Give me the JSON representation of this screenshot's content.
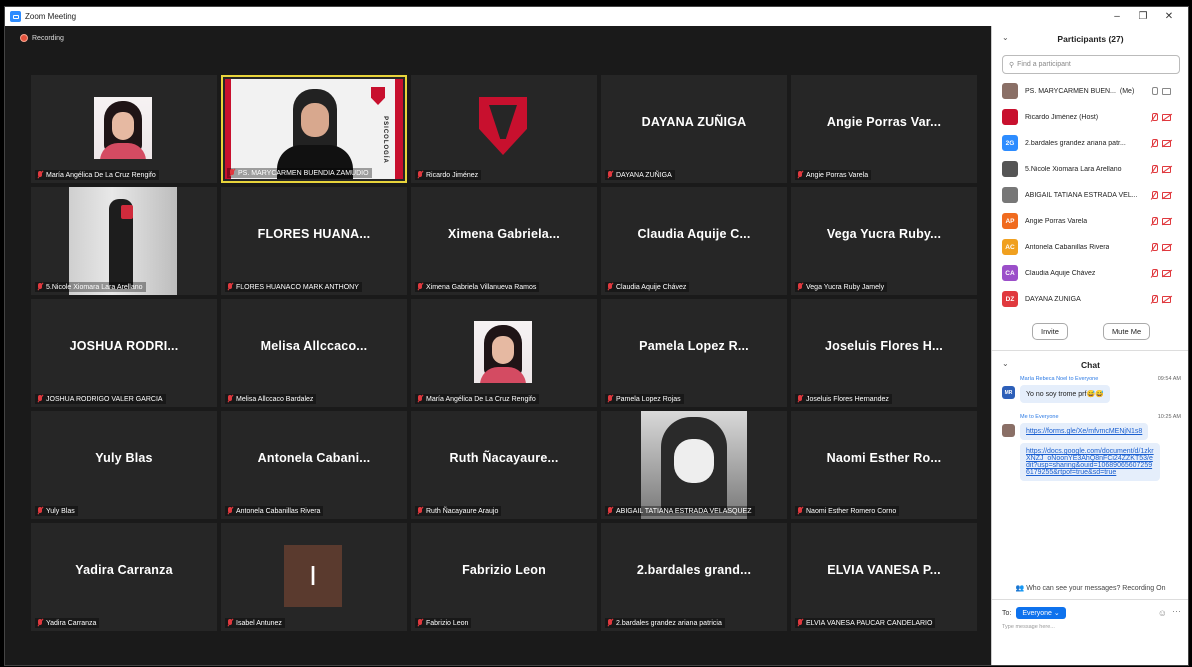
{
  "window": {
    "title": "Zoom Meeting",
    "controls": [
      "–",
      "❐",
      "✕"
    ]
  },
  "recording": {
    "label": "Recording",
    "color": "#e5533d"
  },
  "tiles": [
    {
      "big": "",
      "name": "María Angélica De La Cruz Rengifo",
      "kind": "photo"
    },
    {
      "big": "",
      "name": "PS. MARYCARMEN BUENDIA ZAMUDIO",
      "kind": "video",
      "speaking": true,
      "banner": "PSICOLOGÍA"
    },
    {
      "big": "",
      "name": "Ricardo Jiménez",
      "kind": "logo"
    },
    {
      "big": "DAYANA ZUÑIGA",
      "name": "DAYANA ZUÑIGA",
      "kind": "text"
    },
    {
      "big": "Angie Porras Var...",
      "name": "Angie Porras Varela",
      "kind": "text"
    },
    {
      "big": "",
      "name": "5.Nicole Xiomara Lara Arellano",
      "kind": "mirror"
    },
    {
      "big": "FLORES HUANA...",
      "name": "FLORES HUANACO MARK ANTHONY",
      "kind": "text"
    },
    {
      "big": "Ximena Gabriela...",
      "name": "Ximena Gabriela Villanueva Ramos",
      "kind": "text"
    },
    {
      "big": "Claudia Aquije C...",
      "name": "Claudia Aquije Chávez",
      "kind": "text"
    },
    {
      "big": "Vega Yucra Ruby...",
      "name": "Vega Yucra Ruby Jamely",
      "kind": "text"
    },
    {
      "big": "JOSHUA RODRI...",
      "name": "JOSHUA RODRIGO VALER GARCIA",
      "kind": "text"
    },
    {
      "big": "Melisa Allccaco...",
      "name": "Melisa Allccaco Bardalez",
      "kind": "text"
    },
    {
      "big": "",
      "name": "María Angélica De La Cruz Rengifo",
      "kind": "photo"
    },
    {
      "big": "Pamela Lopez R...",
      "name": "Pamela Lopez Rojas",
      "kind": "text"
    },
    {
      "big": "Joseluis Flores H...",
      "name": "Joseluis Flores Hernandez",
      "kind": "text"
    },
    {
      "big": "Yuly Blas",
      "name": "Yuly Blas",
      "kind": "text"
    },
    {
      "big": "Antonela Cabani...",
      "name": "Antonela Cabanillas Rivera",
      "kind": "text"
    },
    {
      "big": "Ruth Ñacayaure...",
      "name": "Ruth Ñacayaure Araujo",
      "kind": "text"
    },
    {
      "big": "",
      "name": "ABIGAIL TATIANA ESTRADA VELASQUEZ",
      "kind": "anime"
    },
    {
      "big": "Naomi Esther Ro...",
      "name": "Naomi Esther Romero Corno",
      "kind": "text"
    },
    {
      "big": "Yadira Carranza",
      "name": "Yadira Carranza",
      "kind": "text"
    },
    {
      "big": "",
      "name": "Isabel Antunez",
      "kind": "avatar",
      "initial": "I"
    },
    {
      "big": "Fabrizio Leon",
      "name": "Fabrizio Leon",
      "kind": "text"
    },
    {
      "big": "2.bardales grand...",
      "name": "2.bardales grandez ariana patricia",
      "kind": "text"
    },
    {
      "big": "ELVIA VANESA P...",
      "name": "ELVIA VANESA PAUCAR CANDELARIO",
      "kind": "text"
    }
  ],
  "participants": {
    "title": "Participants (27)",
    "search_placeholder": "Find a participant",
    "list": [
      {
        "name": "PS. MARYCARMEN BUEN...",
        "tag": "(Me)",
        "avatar": "",
        "color": "#8a6f66",
        "mic": "on"
      },
      {
        "name": "Ricardo Jiménez (Host)",
        "tag": "",
        "avatar": "",
        "color": "#c8102e",
        "mic": "off"
      },
      {
        "name": "2.bardales grandez ariana patr...",
        "tag": "",
        "avatar": "2G",
        "color": "#2d8cff",
        "mic": "off"
      },
      {
        "name": "5.Nicole Xiomara Lara Arellano",
        "tag": "",
        "avatar": "",
        "color": "#555",
        "mic": "off"
      },
      {
        "name": "ABIGAIL TATIANA ESTRADA VEL...",
        "tag": "",
        "avatar": "",
        "color": "#777",
        "mic": "off"
      },
      {
        "name": "Angie Porras Varela",
        "tag": "",
        "avatar": "AP",
        "color": "#f06b1f",
        "mic": "off"
      },
      {
        "name": "Antonela Cabanillas Rivera",
        "tag": "",
        "avatar": "AC",
        "color": "#f0a01f",
        "mic": "off"
      },
      {
        "name": "Claudia Aquije Chávez",
        "tag": "",
        "avatar": "CA",
        "color": "#9b4fc9",
        "mic": "off"
      },
      {
        "name": "DAYANA ZUÑIGA",
        "tag": "",
        "avatar": "DZ",
        "color": "#e0393e",
        "mic": "off"
      }
    ],
    "invite_label": "Invite",
    "mute_label": "Mute Me"
  },
  "chat": {
    "title": "Chat",
    "messages": [
      {
        "from": "María Rebeca Noel",
        "to": "to Everyone",
        "time": "09:54 AM",
        "avatar": "MR",
        "color": "#2d5fb8",
        "text": "Yo no soy trome prf😅😅"
      },
      {
        "from": "Me",
        "to": "to Everyone",
        "time": "10:25 AM",
        "avatar": "",
        "color": "#8a6f66",
        "text": "https://forms.gle/Xe/mfvmcMENjN1s8",
        "text2": "https://docs.google.com/document/d/1zkrXNZJ_oNoonYE3AhQ8nFCi24ZZKT53/edit?usp=sharing&ouid=106890656072596179255&rtpof=true&sd=true"
      }
    ],
    "visibility_note": "Who can see your messages? Recording On",
    "to_label": "To:",
    "recipient": "Everyone",
    "input_placeholder": "Type message here..."
  }
}
